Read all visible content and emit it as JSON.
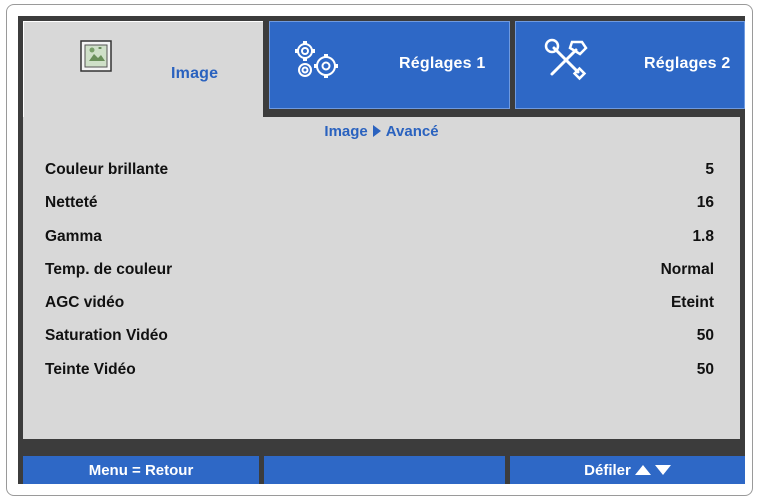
{
  "tabs": [
    {
      "label": "Image",
      "icon": "image-icon"
    },
    {
      "label": "Réglages 1",
      "icon": "gears-icon"
    },
    {
      "label": "Réglages 2",
      "icon": "tools-icon"
    }
  ],
  "breadcrumb": {
    "root": "Image",
    "current": "Avancé"
  },
  "settings": [
    {
      "name": "Couleur brillante",
      "value": "5"
    },
    {
      "name": "Netteté",
      "value": "16"
    },
    {
      "name": "Gamma",
      "value": "1.8"
    },
    {
      "name": "Temp. de couleur",
      "value": "Normal"
    },
    {
      "name": "AGC vidéo",
      "value": "Eteint"
    },
    {
      "name": "Saturation Vidéo",
      "value": "50"
    },
    {
      "name": "Teinte Vidéo",
      "value": "50"
    }
  ],
  "footer": {
    "left": "Menu = Retour",
    "right": "Défiler"
  },
  "colors": {
    "accent": "#2e68c6",
    "panel": "#d8d8d8",
    "frame": "#3c3c3c"
  }
}
